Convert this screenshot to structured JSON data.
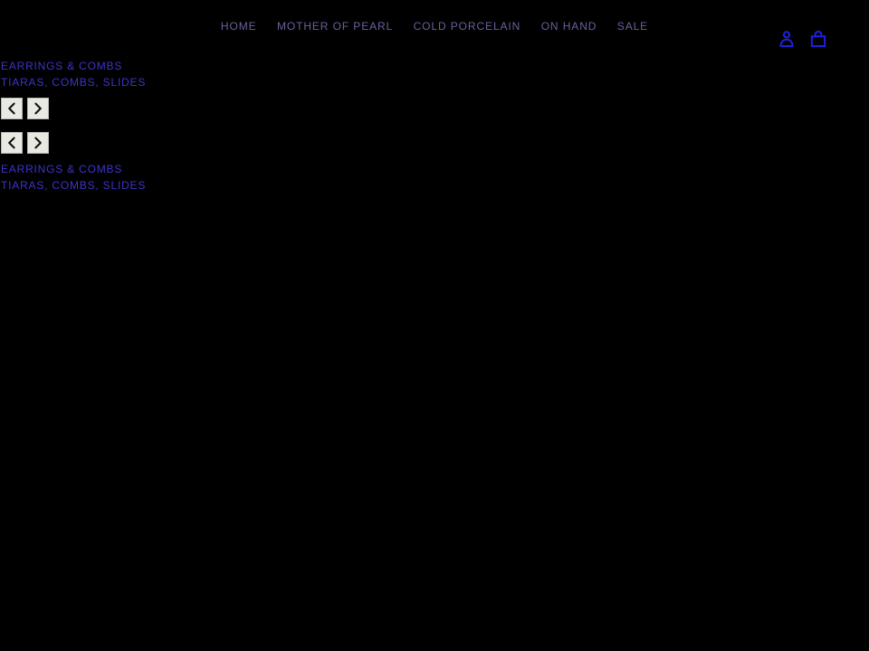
{
  "page": {
    "background_color": "#000000",
    "nav_link_color": "#6e5f9e",
    "category_link_color": "#3d34c8",
    "icon_color": "#2020e0",
    "button_face_color": "#e9e9e4"
  },
  "header": {
    "nav": [
      {
        "label": "HOME",
        "name": "nav-item-home"
      },
      {
        "label": "MOTHER OF PEARL",
        "name": "nav-item-mother-of-pearl"
      },
      {
        "label": "COLD PORCELAIN",
        "name": "nav-item-cold-porcelain"
      },
      {
        "label": "ON HAND",
        "name": "nav-item-on-hand"
      },
      {
        "label": "SALE",
        "name": "nav-item-sale"
      }
    ],
    "utility_icons": [
      {
        "name": "account-icon",
        "label": "Account"
      },
      {
        "name": "shopping-bag-icon",
        "label": "Cart"
      }
    ]
  },
  "main": {
    "top_section": {
      "links": [
        {
          "label": "EARRINGS & COMBS"
        },
        {
          "label": "TIARAS, COMBS, SLIDES"
        }
      ],
      "carousel_controls": [
        {
          "label": "‹",
          "name": "carousel-prev-button"
        },
        {
          "label": "›",
          "name": "carousel-next-button"
        }
      ]
    },
    "second_section": {
      "carousel_controls": [
        {
          "label": "‹",
          "name": "carousel-prev-button"
        },
        {
          "label": "›",
          "name": "carousel-next-button"
        }
      ],
      "links": [
        {
          "label": "EARRINGS & COMBS"
        },
        {
          "label": "TIARAS, COMBS, SLIDES"
        }
      ]
    }
  }
}
